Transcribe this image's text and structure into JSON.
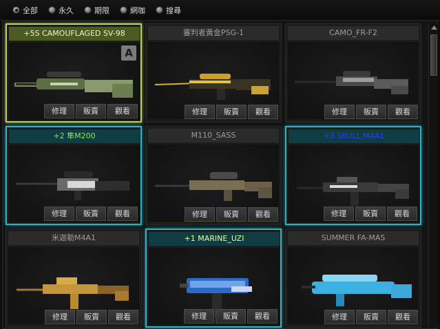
{
  "filters": [
    {
      "label": "全部",
      "checked": true
    },
    {
      "label": "永久",
      "checked": false
    },
    {
      "label": "期限",
      "checked": false
    },
    {
      "label": "網咖",
      "checked": false
    },
    {
      "label": "搜尋",
      "checked": false
    }
  ],
  "actions": {
    "repair": "修理",
    "sell": "販賣",
    "view": "觀看"
  },
  "items": [
    {
      "name": "+5S CAMOUFLAGED SV-98",
      "style": "selected-yellow",
      "badge": "A",
      "weapon": "sniper-camo"
    },
    {
      "name": "審判者黃金PSG-1",
      "style": "normal",
      "badge": "",
      "weapon": "psg1-gold"
    },
    {
      "name": "CAMO_FR-F2",
      "style": "normal",
      "badge": "",
      "weapon": "frf2"
    },
    {
      "name": "+2 隼M200",
      "style": "selected-cyan-green",
      "badge": "",
      "weapon": "m200"
    },
    {
      "name": "M110_SASS",
      "style": "normal",
      "badge": "",
      "weapon": "m110"
    },
    {
      "name": "+3 SKULL M4A1",
      "style": "selected-cyan-blue",
      "badge": "",
      "weapon": "m4a1"
    },
    {
      "name": "米迦勒M4A1",
      "style": "normal",
      "badge": "",
      "weapon": "m4a1-gold"
    },
    {
      "name": "+1 MARINE_UZI",
      "style": "selected-cyan-lime",
      "badge": "",
      "weapon": "uzi"
    },
    {
      "name": "SUMMER FA-MAS",
      "style": "normal",
      "badge": "",
      "weapon": "famas"
    }
  ],
  "colors": {
    "selected_yellow": "#b8cf6a",
    "selected_cyan": "#2fb3c4",
    "title_green": "#8ee35b",
    "title_blue": "#2f3cff",
    "title_lime": "#e6ff9a"
  }
}
